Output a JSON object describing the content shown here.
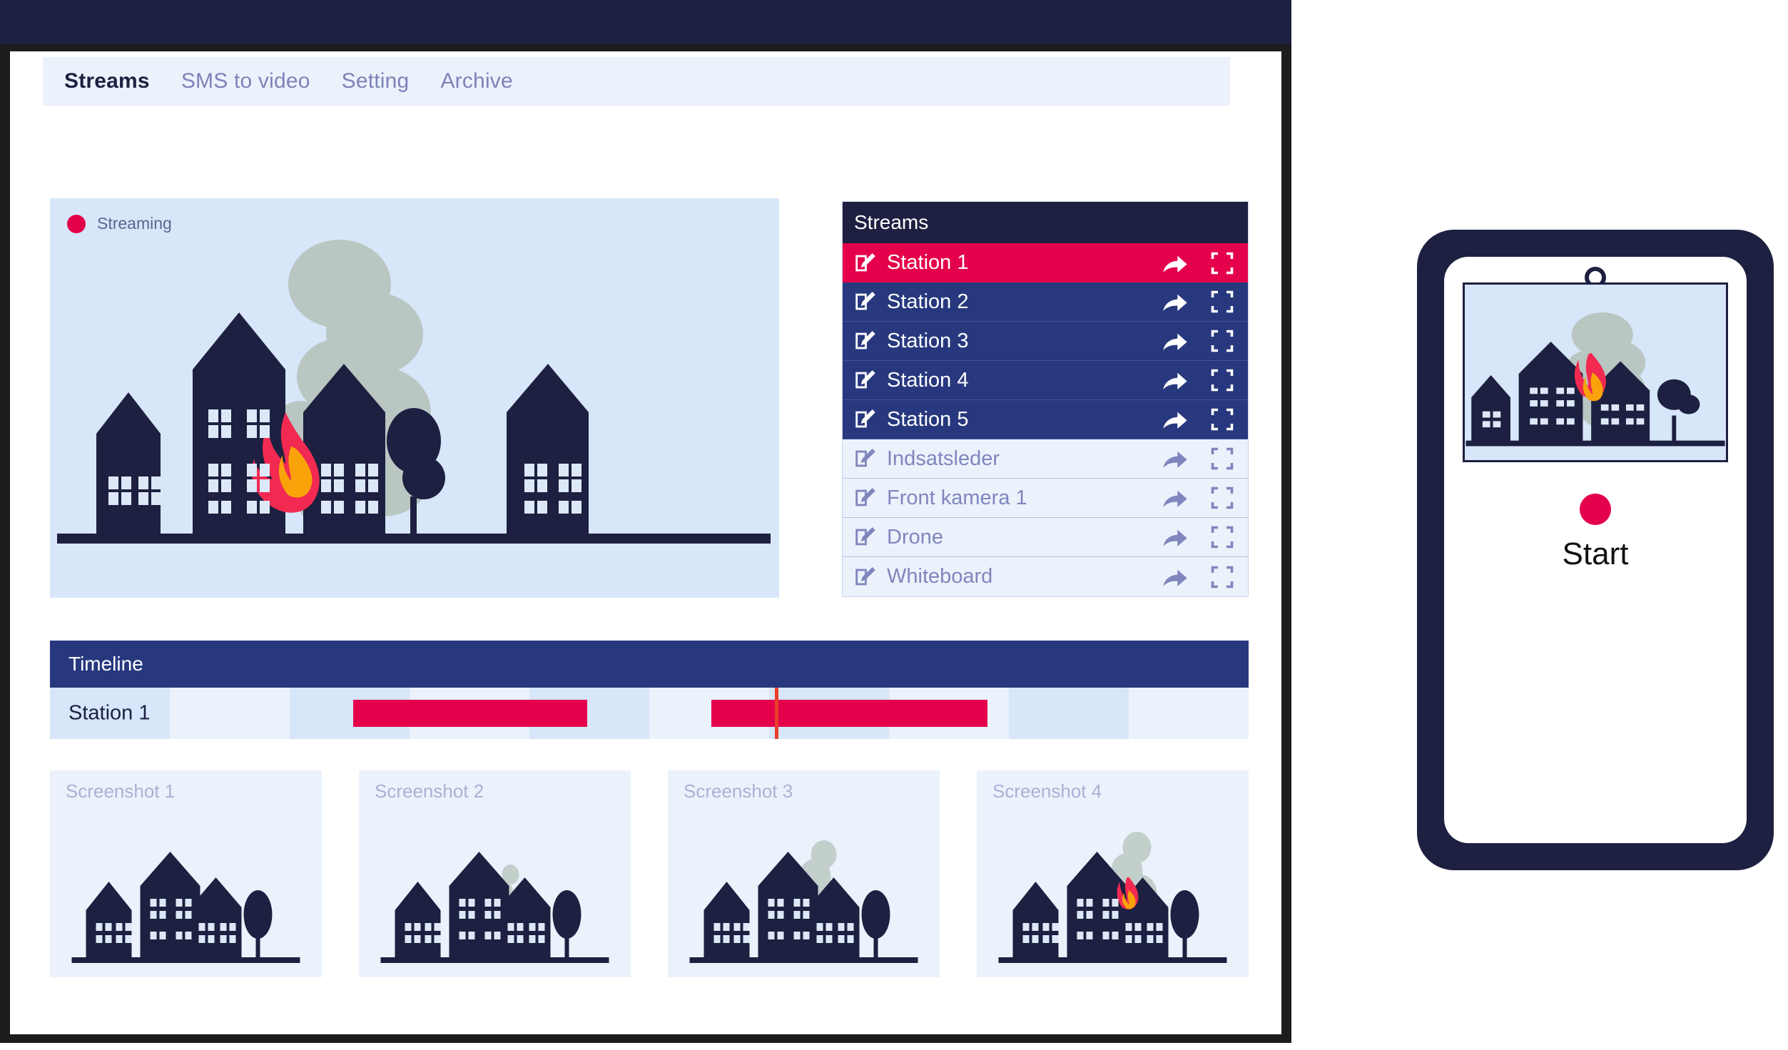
{
  "window": {
    "title_bar": ""
  },
  "tabs": [
    {
      "label": "Streams",
      "active": true
    },
    {
      "label": "SMS to video",
      "active": false
    },
    {
      "label": "Setting",
      "active": false
    },
    {
      "label": "Archive",
      "active": false
    }
  ],
  "video": {
    "status_label": "Streaming",
    "status_color": "#e4004b",
    "scene": "burning-houses"
  },
  "streams_panel": {
    "header": "Streams",
    "items": [
      {
        "label": "Station 1",
        "state": "active"
      },
      {
        "label": "Station 2",
        "state": "on"
      },
      {
        "label": "Station 3",
        "state": "on"
      },
      {
        "label": "Station 4",
        "state": "on"
      },
      {
        "label": "Station 5",
        "state": "on"
      },
      {
        "label": "Indsatsleder",
        "state": "off"
      },
      {
        "label": "Front kamera 1",
        "state": "off"
      },
      {
        "label": "Drone",
        "state": "off"
      },
      {
        "label": "Whiteboard",
        "state": "off"
      }
    ],
    "row_icons": [
      "edit-icon",
      "share-icon",
      "fullscreen-icon"
    ]
  },
  "timeline": {
    "header": "Timeline",
    "row_label": "Station 1",
    "cells": 10,
    "clips": [
      {
        "left_pct": 25.3,
        "width_pct": 19.5
      },
      {
        "left_pct": 55.2,
        "width_pct": 23.0
      }
    ],
    "playhead_pct": 60.5
  },
  "screenshots": [
    {
      "label": "Screenshot 1",
      "stage": "none"
    },
    {
      "label": "Screenshot 2",
      "stage": "small-smoke"
    },
    {
      "label": "Screenshot 3",
      "stage": "big-smoke"
    },
    {
      "label": "Screenshot 4",
      "stage": "fire"
    }
  ],
  "tablet": {
    "start_label": "Start",
    "record_color": "#e4004b"
  },
  "colors": {
    "navy_dark": "#1d2040",
    "navy_mid": "#27387e",
    "red": "#e4004b",
    "pale_blue": "#ebf2fc",
    "mid_blue": "#d7e6f8",
    "muted_text": "#8086bd",
    "smoke": "#b9c6c2",
    "flame_outer": "#f22a52",
    "flame_inner": "#f9a20a"
  }
}
